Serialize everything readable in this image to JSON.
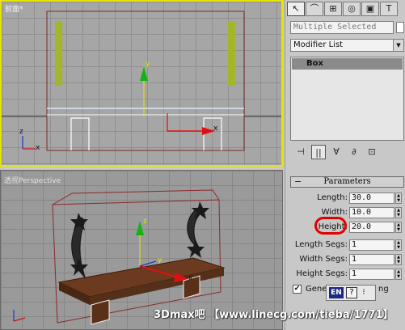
{
  "viewports": {
    "front": {
      "label": "前面*",
      "axis_x": "x",
      "axis_y": "y",
      "axis_z": "z"
    },
    "perspective": {
      "label": "透视Perspective",
      "axis_x": "x",
      "axis_y": "y",
      "axis_z": "z"
    }
  },
  "command_panel": {
    "tabs": [
      {
        "icon": "pointer-icon",
        "glyph": "↖"
      },
      {
        "icon": "bend-icon",
        "glyph": "⌒"
      },
      {
        "icon": "hierarchy-icon",
        "glyph": "⊞"
      },
      {
        "icon": "motion-icon",
        "glyph": "◎"
      },
      {
        "icon": "display-icon",
        "glyph": "▣"
      },
      {
        "icon": "utilities-icon",
        "glyph": "T"
      }
    ],
    "selection_field": "Multiple Selected",
    "modifier_list": "Modifier List",
    "stack_item": "Box",
    "stack_buttons": [
      {
        "icon": "pin-stack-icon",
        "glyph": "⊣"
      },
      {
        "icon": "show-end-result-icon",
        "glyph": "||"
      },
      {
        "icon": "make-unique-icon",
        "glyph": "∀"
      },
      {
        "icon": "remove-modifier-icon",
        "glyph": "∂"
      },
      {
        "icon": "configure-modifier-sets-icon",
        "glyph": "⊡"
      }
    ],
    "rollout_title": "Parameters",
    "parameters": [
      {
        "label": "Length:",
        "value": "30.0"
      },
      {
        "label": "Width:",
        "value": "10.0"
      },
      {
        "label": "Height:",
        "value": "20.0"
      },
      {
        "label": "Length Segs:",
        "value": "1"
      },
      {
        "label": "Width Segs:",
        "value": "1"
      },
      {
        "label": "Height Segs:",
        "value": "1"
      }
    ],
    "generate_label": "Gene",
    "generate_tail": "ng",
    "generate_checked": "✔"
  },
  "ime": {
    "en": "EN",
    "help": "?",
    "menu": "⁝"
  },
  "watermark": "3Dmax吧 【www.linecg.com/tieba/1771】",
  "colors": {
    "active_border": "#e8e400",
    "highlight_circle": "#e00000",
    "bench_wood": "#6b3a1f"
  }
}
